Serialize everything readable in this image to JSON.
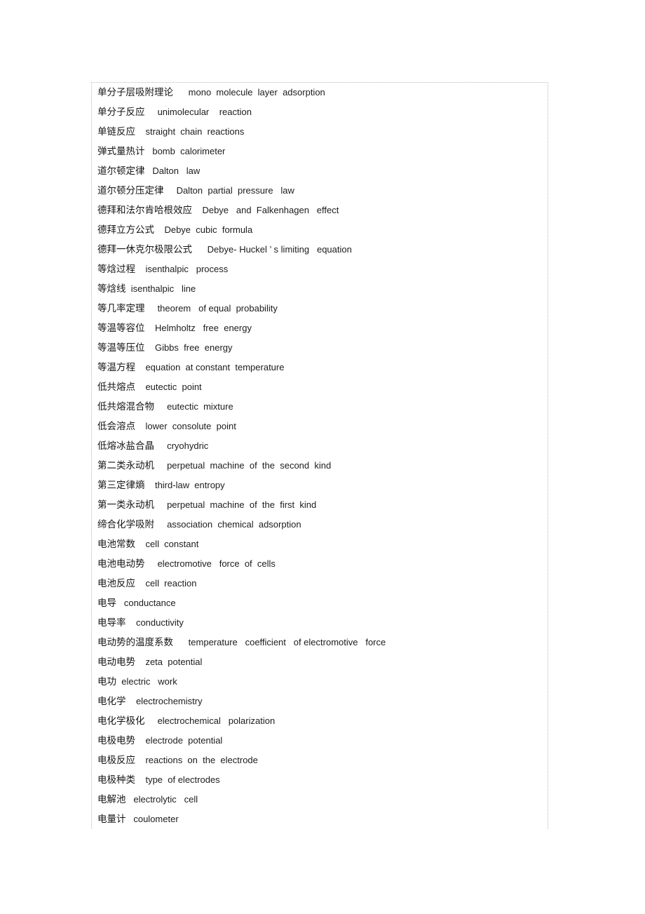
{
  "document": {
    "kind": "bilingual-glossary",
    "language_pair": "chinese-english",
    "subject_hint": "physical chemistry terms",
    "rows": [
      {
        "cn": "单分子层吸附理论",
        "gap": "      ",
        "en": "mono  molecule  layer  adsorption"
      },
      {
        "cn": "单分子反应",
        "gap": "     ",
        "en": "unimolecular    reaction"
      },
      {
        "cn": "单链反应",
        "gap": "    ",
        "en": "straight  chain  reactions"
      },
      {
        "cn": "弹式量热计",
        "gap": "   ",
        "en": "bomb  calorimeter"
      },
      {
        "cn": "道尔顿定律",
        "gap": "   ",
        "en": "Dalton   law"
      },
      {
        "cn": "道尔顿分压定律",
        "gap": "     ",
        "en": "Dalton  partial  pressure   law"
      },
      {
        "cn": "德拜和法尔肯哈根效应",
        "gap": "    ",
        "en": "Debye   and  Falkenhagen   effect"
      },
      {
        "cn": "德拜立方公式",
        "gap": "    ",
        "en": "Debye  cubic  formula"
      },
      {
        "cn": "德拜一休克尔极限公式",
        "gap": "      ",
        "en": "Debye- Huckel ’ s limiting   equation"
      },
      {
        "cn": "等焓过程",
        "gap": "    ",
        "en": "isenthalpic   process"
      },
      {
        "cn": "等焓线",
        "gap": "  ",
        "en": "isenthalpic   line"
      },
      {
        "cn": "等几率定理",
        "gap": "     ",
        "en": "theorem   of equal  probability"
      },
      {
        "cn": "等温等容位",
        "gap": "    ",
        "en": "Helmholtz   free  energy"
      },
      {
        "cn": "等温等压位",
        "gap": "    ",
        "en": "Gibbs  free  energy"
      },
      {
        "cn": "等温方程",
        "gap": "    ",
        "en": "equation  at constant  temperature"
      },
      {
        "cn": "低共熔点",
        "gap": "    ",
        "en": "eutectic  point"
      },
      {
        "cn": "低共熔混合物",
        "gap": "     ",
        "en": "eutectic  mixture"
      },
      {
        "cn": "低会溶点",
        "gap": "    ",
        "en": "lower  consolute  point"
      },
      {
        "cn": "低熔冰盐合晶",
        "gap": "     ",
        "en": "cryohydric"
      },
      {
        "cn": "第二类永动机",
        "gap": "     ",
        "en": "perpetual  machine  of  the  second  kind"
      },
      {
        "cn": "第三定律熵",
        "gap": "    ",
        "en": "third-law  entropy"
      },
      {
        "cn": "第一类永动机",
        "gap": "     ",
        "en": "perpetual  machine  of  the  first  kind"
      },
      {
        "cn": "缔合化学吸附",
        "gap": "     ",
        "en": "association  chemical  adsorption"
      },
      {
        "cn": "电池常数",
        "gap": "    ",
        "en": "cell  constant"
      },
      {
        "cn": "电池电动势",
        "gap": "     ",
        "en": "electromotive   force  of  cells"
      },
      {
        "cn": "电池反应",
        "gap": "    ",
        "en": "cell  reaction"
      },
      {
        "cn": "电导",
        "gap": "   ",
        "en": "conductance"
      },
      {
        "cn": "电导率",
        "gap": "    ",
        "en": "conductivity"
      },
      {
        "cn": "电动势的温度系数",
        "gap": "      ",
        "en": "temperature   coefficient   of electromotive   force"
      },
      {
        "cn": "电动电势",
        "gap": "    ",
        "en": "zeta  potential"
      },
      {
        "cn": "电功",
        "gap": "  ",
        "en": "electric   work"
      },
      {
        "cn": "电化学",
        "gap": "    ",
        "en": "electrochemistry"
      },
      {
        "cn": "电化学极化",
        "gap": "     ",
        "en": "electrochemical   polarization"
      },
      {
        "cn": "电极电势",
        "gap": "    ",
        "en": "electrode  potential"
      },
      {
        "cn": "电极反应",
        "gap": "    ",
        "en": "reactions  on  the  electrode"
      },
      {
        "cn": "电极种类",
        "gap": "    ",
        "en": "type  of electrodes"
      },
      {
        "cn": "电解池",
        "gap": "   ",
        "en": "electrolytic   cell"
      },
      {
        "cn": "电量计",
        "gap": "   ",
        "en": "coulometer"
      }
    ]
  },
  "style": {
    "text_color": "#1c1c1c",
    "border_color": "#b9b9b9",
    "background_color": "#ffffff"
  }
}
